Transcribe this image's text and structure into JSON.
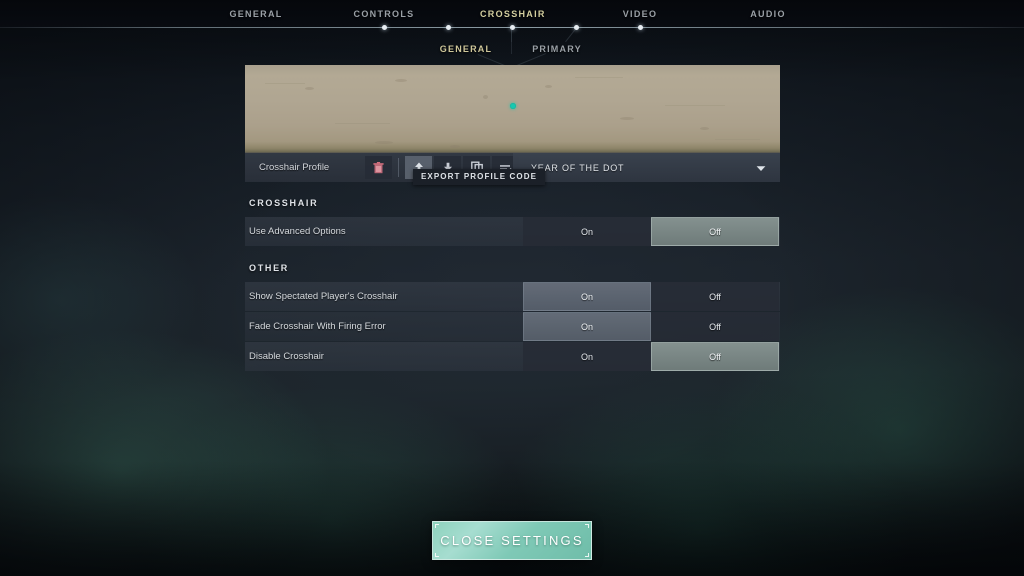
{
  "nav": {
    "tabs": [
      {
        "label": "GENERAL",
        "active": false
      },
      {
        "label": "CONTROLS",
        "active": false
      },
      {
        "label": "CROSSHAIR",
        "active": true
      },
      {
        "label": "VIDEO",
        "active": false
      },
      {
        "label": "AUDIO",
        "active": false
      }
    ],
    "subtabs": [
      {
        "label": "GENERAL",
        "active": true
      },
      {
        "label": "PRIMARY",
        "active": false
      }
    ]
  },
  "profile": {
    "label": "Crosshair Profile",
    "delete_icon": "trash-icon",
    "actions": [
      {
        "icon": "upload-arrow-up-icon",
        "hovered": true
      },
      {
        "icon": "download-arrow-down-icon",
        "hovered": false
      },
      {
        "icon": "copy-icon",
        "hovered": false
      },
      {
        "icon": "list-edit-icon",
        "hovered": false
      }
    ],
    "tooltip": "EXPORT PROFILE CODE",
    "dropdown_value": "YEAR OF THE DOT",
    "dropdown_caret": "chevron-down-icon"
  },
  "preview": {
    "crosshair_color": "#19c8b0",
    "background_color": "#b0a692"
  },
  "sections": [
    {
      "header": "CROSSHAIR",
      "rows": [
        {
          "label": "Use Advanced Options",
          "options": [
            {
              "label": "On",
              "selected": false
            },
            {
              "label": "Off",
              "selected": true
            }
          ]
        }
      ]
    },
    {
      "header": "OTHER",
      "rows": [
        {
          "label": "Show Spectated Player's Crosshair",
          "options": [
            {
              "label": "On",
              "selected": true
            },
            {
              "label": "Off",
              "selected": false
            }
          ]
        },
        {
          "label": "Fade Crosshair With Firing Error",
          "options": [
            {
              "label": "On",
              "selected": true
            },
            {
              "label": "Off",
              "selected": false
            }
          ]
        },
        {
          "label": "Disable Crosshair",
          "options": [
            {
              "label": "On",
              "selected": false
            },
            {
              "label": "Off",
              "selected": true
            }
          ]
        }
      ]
    }
  ],
  "footer": {
    "close_label": "CLOSE SETTINGS",
    "accent_color": "#8ed2bd"
  }
}
